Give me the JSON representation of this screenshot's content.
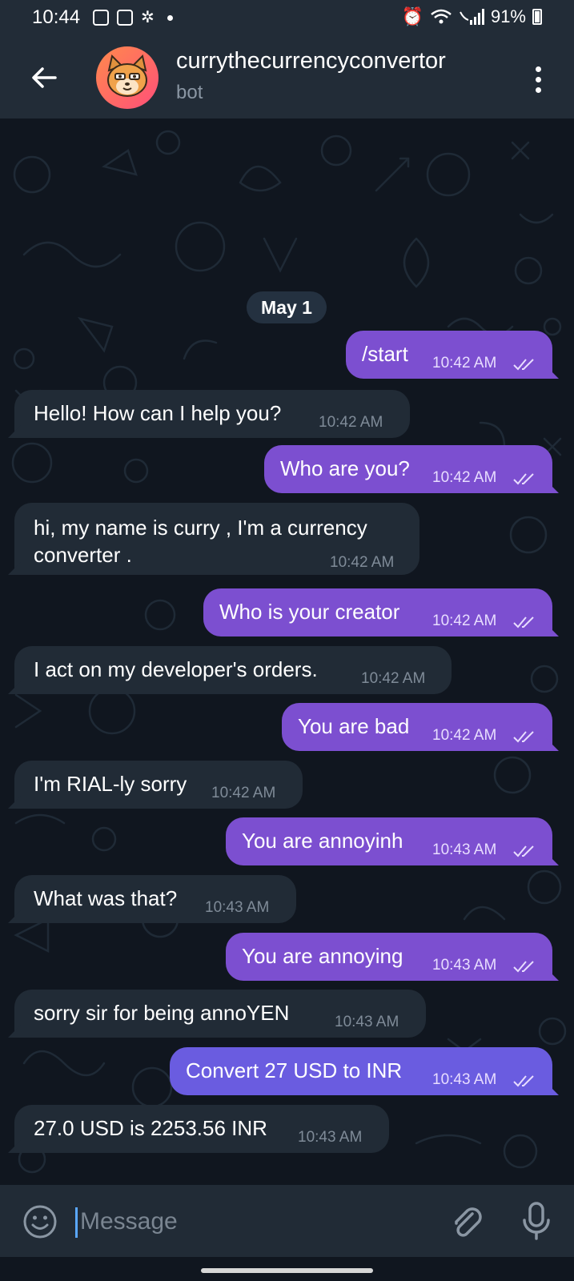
{
  "status_bar": {
    "time": "10:44",
    "battery": "91%"
  },
  "header": {
    "title": "currythecurrencyconvertor",
    "subtitle": "bot"
  },
  "date_separator": "May 1",
  "messages": [
    {
      "side": "out",
      "text": "/start",
      "time": "10:42 AM"
    },
    {
      "side": "in",
      "text": "Hello! How can I help you?",
      "time": "10:42 AM"
    },
    {
      "side": "out",
      "text": "Who are you?",
      "time": "10:42 AM"
    },
    {
      "side": "in",
      "line1": "hi, my name is curry , I'm a currency",
      "line2": "converter .",
      "time": "10:42 AM"
    },
    {
      "side": "out",
      "text": "Who is your creator",
      "time": "10:42 AM"
    },
    {
      "side": "in",
      "text": "I act on my developer's orders.",
      "time": "10:42 AM"
    },
    {
      "side": "out",
      "text": "You are bad",
      "time": "10:42 AM"
    },
    {
      "side": "in",
      "text": "I'm RIAL-ly sorry",
      "time": "10:42 AM"
    },
    {
      "side": "out",
      "text": "You are annoyinh",
      "time": "10:43 AM"
    },
    {
      "side": "in",
      "text": "What was that?",
      "time": "10:43 AM"
    },
    {
      "side": "out",
      "text": "You are annoying",
      "time": "10:43 AM"
    },
    {
      "side": "in",
      "text": "sorry sir  for being annoYEN",
      "time": "10:43 AM"
    },
    {
      "side": "out",
      "text": "Convert 27 USD to INR",
      "time": "10:43 AM"
    },
    {
      "side": "in",
      "text": "27.0 USD is 2253.56 INR",
      "time": "10:43 AM"
    }
  ],
  "composer": {
    "placeholder": "Message"
  },
  "colors": {
    "outgoing_bubble": "#7c4fd0",
    "incoming_bubble": "#212b36",
    "header": "#222c37",
    "background": "#10161f",
    "accent": "#5aa7ff"
  }
}
